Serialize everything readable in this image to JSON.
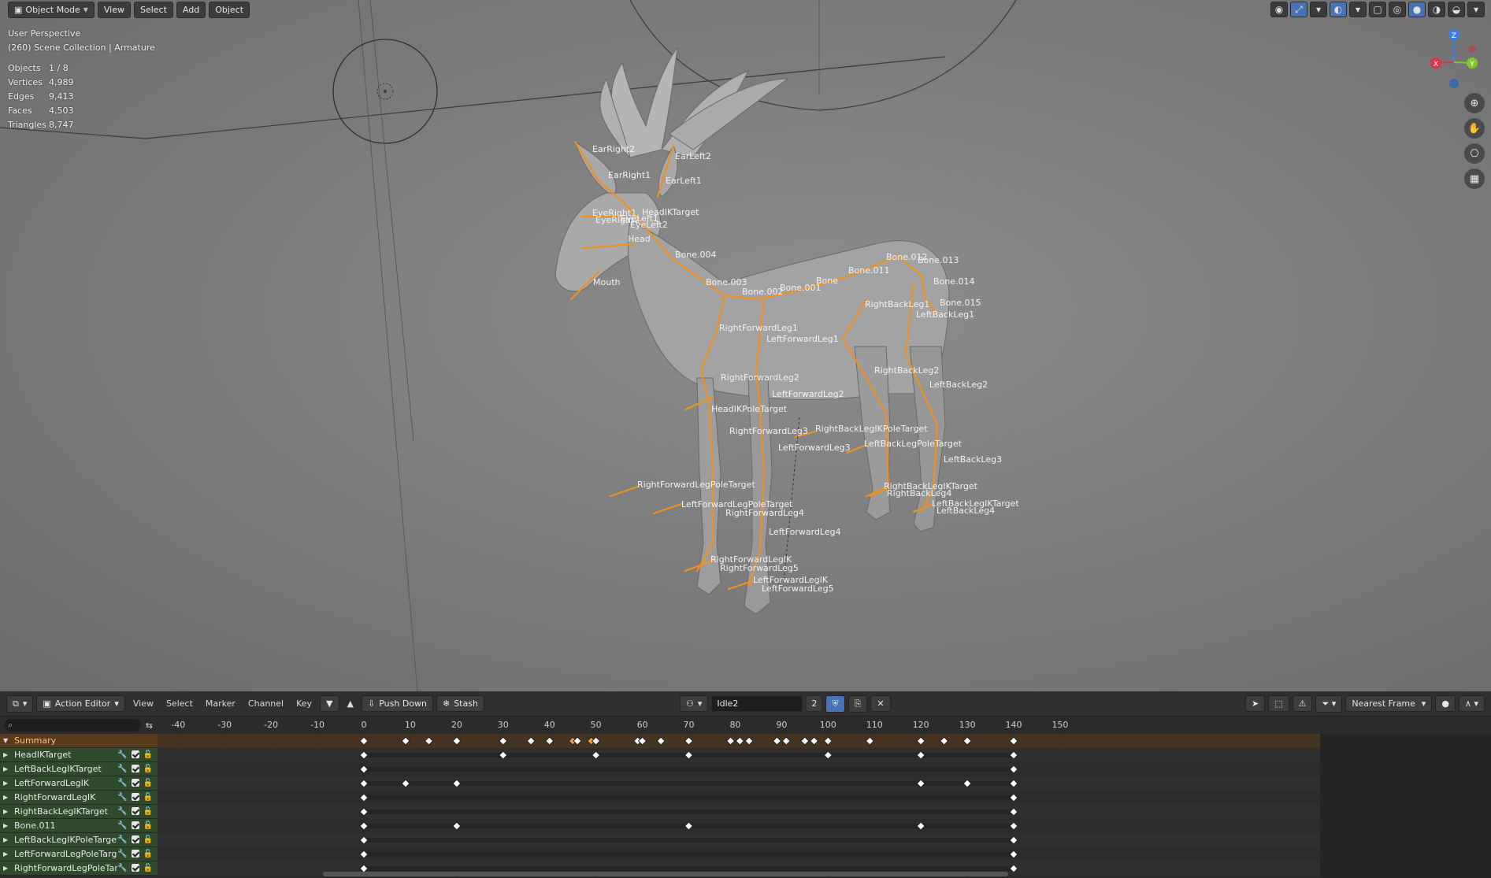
{
  "viewport": {
    "mode_label": "Object Mode",
    "menus": [
      "View",
      "Select",
      "Add",
      "Object"
    ],
    "perspective": "User Perspective",
    "collection": "(260) Scene Collection | Armature",
    "stats": [
      {
        "label": "Objects",
        "value": "1 / 8"
      },
      {
        "label": "Vertices",
        "value": "4,989"
      },
      {
        "label": "Edges",
        "value": "9,413"
      },
      {
        "label": "Faces",
        "value": "4,503"
      },
      {
        "label": "Triangles",
        "value": "8,747"
      }
    ],
    "gizmo_axes": {
      "z": "Z",
      "x": "X",
      "y": "Y"
    },
    "axis_colors": {
      "x": "#e0334a",
      "y": "#7ec72a",
      "z": "#3b7fe0"
    },
    "bone_color": "#f0901e",
    "bone_labels": [
      "EarRight2",
      "EarRight1",
      "EarLeft2",
      "EarLeft1",
      "EyeRight1",
      "EyeRight2",
      "EyeLeft1",
      "EyeLeft2",
      "HeadIKTarget",
      "Head",
      "Bone.004",
      "Mouth",
      "Bone.003",
      "Bone.002",
      "Bone.001",
      "Bone",
      "Bone.011",
      "Bone.012",
      "Bone.013",
      "Bone.014",
      "Bone.015",
      "RightBackLeg1",
      "LeftBackLeg1",
      "RightForwardLeg1",
      "LeftForwardLeg1",
      "RightForwardLeg2",
      "LeftForwardLeg2",
      "HeadIKPoleTarget",
      "RightBackLeg2",
      "LeftBackLeg2",
      "RightBackLegIKPoleTarget",
      "RightForwardLeg3",
      "LeftForwardLeg3",
      "LeftBackLegPoleTarget",
      "LeftBackLeg3",
      "RightForwardLegPoleTarget",
      "LeftForwardLegPoleTarget",
      "RightForwardLeg4",
      "RightBackLegIKTarget",
      "RightBackLeg4",
      "LeftBackLegIKTarget",
      "LeftBackLeg4",
      "LeftForwardLeg4",
      "RightForwardLegIK",
      "RightForwardLeg5",
      "LeftForwardLegIK",
      "LeftForwardLeg5"
    ]
  },
  "editor": {
    "editor_label": "Action Editor",
    "menus": [
      "View",
      "Select",
      "Marker",
      "Channel",
      "Key"
    ],
    "push_down": "Push Down",
    "stash": "Stash",
    "action_name": "Idle2",
    "users": "2",
    "snapping": "Nearest Frame",
    "ruler_ticks": [
      "-40",
      "-30",
      "-20",
      "-10",
      "0",
      "10",
      "20",
      "30",
      "40",
      "50",
      "60",
      "70",
      "80",
      "90",
      "100",
      "110",
      "120",
      "130",
      "140",
      "150"
    ],
    "channels": [
      {
        "name": "Summary",
        "keys": [
          0,
          9,
          14,
          20,
          30,
          36,
          40,
          45,
          46,
          49,
          50,
          59,
          60,
          64,
          70,
          79,
          81,
          83,
          89,
          91,
          95,
          97,
          100,
          109,
          120,
          125,
          130,
          140
        ]
      },
      {
        "name": "HeadIKTarget",
        "keys": [
          0,
          30,
          50,
          70,
          100,
          120,
          140
        ]
      },
      {
        "name": "LeftBackLegIKTarget",
        "keys": [
          0,
          140
        ]
      },
      {
        "name": "LeftForwardLegIK",
        "keys": [
          0,
          9,
          20,
          120,
          130,
          140
        ]
      },
      {
        "name": "RightForwardLegIK",
        "keys": [
          0,
          140
        ]
      },
      {
        "name": "RightBackLegIKTarget",
        "keys": [
          0,
          140
        ]
      },
      {
        "name": "Bone.011",
        "keys": [
          0,
          20,
          70,
          120,
          140
        ]
      },
      {
        "name": "LeftBackLegIKPoleTarget",
        "keys": [
          0,
          140
        ]
      },
      {
        "name": "LeftForwardLegPoleTarget",
        "keys": [
          0,
          140
        ]
      },
      {
        "name": "RightForwardLegPoleTarg",
        "keys": [
          0,
          140
        ]
      }
    ]
  }
}
